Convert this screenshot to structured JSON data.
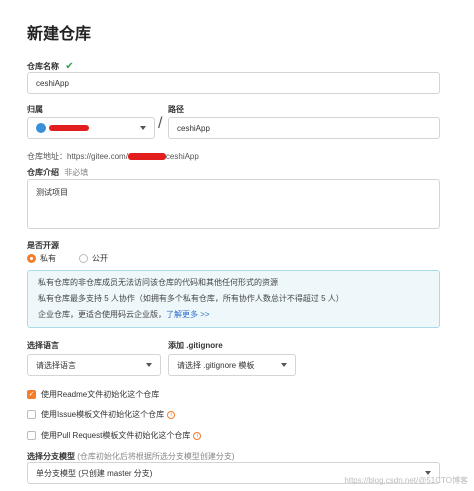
{
  "page": {
    "title": "新建仓库"
  },
  "repo_name": {
    "label": "仓库名称",
    "value": "ceshiApp"
  },
  "owner": {
    "label": "归属"
  },
  "path": {
    "label": "路径",
    "separator": "/",
    "value": "ceshiApp"
  },
  "address": {
    "prefix": "仓库地址：https://gitee.com/",
    "suffix": "ceshiApp"
  },
  "description": {
    "label": "仓库介绍",
    "optional": "非必填",
    "value": "测试项目"
  },
  "visibility": {
    "label": "是否开源",
    "options": [
      {
        "label": "私有",
        "selected": true
      },
      {
        "label": "公开",
        "selected": false
      }
    ]
  },
  "notice": {
    "line1": "私有仓库的非仓库成员无法访问该仓库的代码和其他任何形式的资源",
    "line2": "私有仓库最多支持 5 人协作（如拥有多个私有仓库，所有协作人数总计不得超过 5 人）",
    "line3_text": "企业仓库，更适合使用码云企业版，",
    "line3_link": "了解更多 >>"
  },
  "language": {
    "label": "选择语言",
    "placeholder": "请选择语言"
  },
  "gitignore": {
    "label": "添加 .gitignore",
    "placeholder": "请选择 .gitignore 模板"
  },
  "options": [
    {
      "label": "使用Readme文件初始化这个仓库",
      "checked": true,
      "info": false
    },
    {
      "label": "使用Issue模板文件初始化这个仓库",
      "checked": false,
      "info": true
    },
    {
      "label": "使用Pull Request模板文件初始化这个仓库",
      "checked": false,
      "info": true
    }
  ],
  "branch_model": {
    "label": "选择分支模型",
    "hint": "(仓库初始化后将根据所选分支模型创建分支)",
    "value": "单分支模型 (只创建 master 分支)"
  },
  "watermark": "https://blog.csdn.net/@51CTO博客",
  "colors": {
    "accent": "#f57c2b",
    "check": "#2ea44f",
    "link": "#2f6ec7",
    "notice_bg": "#eef8fb"
  }
}
